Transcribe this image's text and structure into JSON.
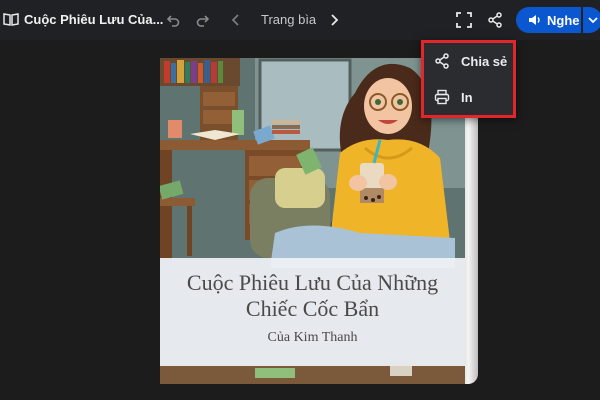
{
  "app": {
    "title": "Cuộc Phiêu Lưu Của...",
    "page_label": "Trang bìa"
  },
  "toolbar": {
    "undo_icon": "undo-icon",
    "redo_icon": "redo-icon",
    "prev_icon": "chevron-left-icon",
    "next_icon": "chevron-right-icon",
    "fullscreen_icon": "fullscreen-icon",
    "share_icon": "share-icon",
    "listen_label": "Nghe",
    "listen_icon": "speaker-icon",
    "dropdown_icon": "chevron-down-icon",
    "accent_color": "#0b57d0"
  },
  "book": {
    "title": "Cuộc Phiêu Lưu Của Những Chiếc Cốc Bẩn",
    "title_line1": "Cuộc Phiêu Lưu Của Những",
    "title_line2": "Chiếc Cốc Bẩn",
    "author": "Của Kim Thanh"
  },
  "menu": {
    "highlight_color": "#e2262b",
    "items": [
      {
        "label": "Chia sẻ",
        "icon": "share-icon"
      },
      {
        "label": "In",
        "icon": "print-icon"
      }
    ]
  }
}
